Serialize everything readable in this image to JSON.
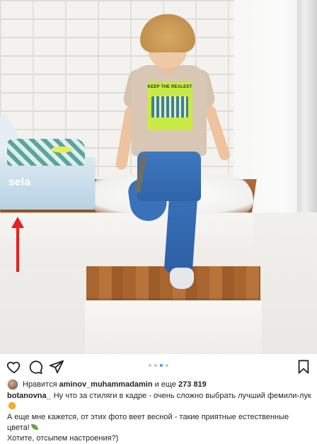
{
  "post": {
    "image": {
      "box_label": "sela",
      "tshirt_print": "KEEP THE REALEST"
    },
    "carousel": {
      "count": 4,
      "active_index": 2
    },
    "actions": {
      "like_icon": "heart-icon",
      "comment_icon": "comment-bubble-icon",
      "share_icon": "paper-plane-icon",
      "save_icon": "bookmark-icon"
    },
    "likes": {
      "prefix": "Нравится",
      "username": "aminov_muhammadamin",
      "connector": "и еще",
      "count": "273 819"
    },
    "caption": {
      "username": "botanovna_",
      "line1": "Ну что за стиляги в кадре - очень сложно выбрать лучший фемили-лук",
      "line2": "А еще мне кажется, от этих фото веет весной - такие приятные естественные цвета!",
      "line3": "Хотите, отсыпем настроения?)"
    },
    "annotation": {
      "arrow_color": "#e8201f"
    },
    "colors": {
      "accent_blue": "#3897f0",
      "text": "#262626"
    }
  }
}
